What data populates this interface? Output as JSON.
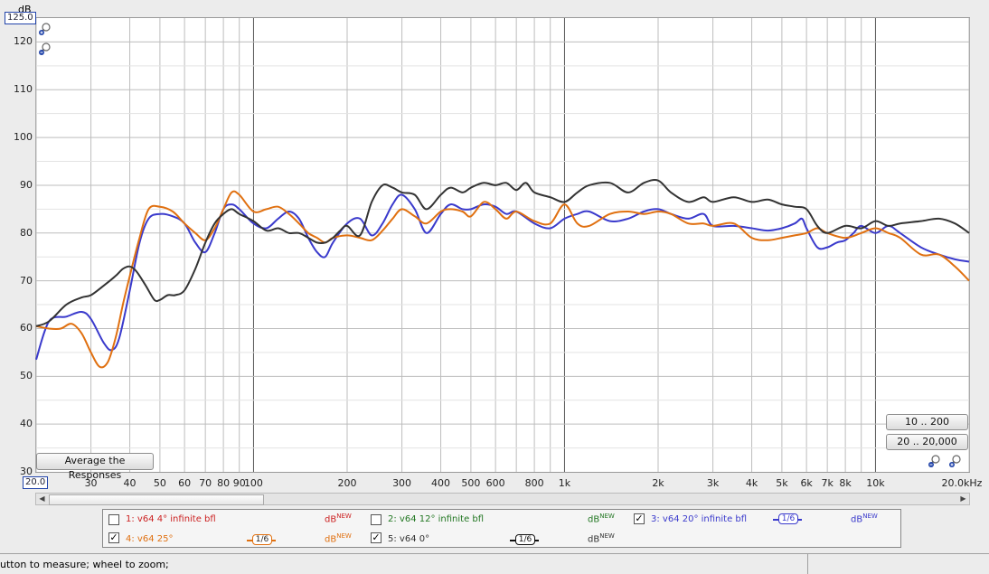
{
  "chart_data": {
    "type": "line",
    "x_scale": "log",
    "xlim": [
      20,
      20000
    ],
    "ylim": [
      30,
      125
    ],
    "y_unit": "dB",
    "x_unit": "kHz",
    "y_ticks": [
      "125.0",
      "120",
      "110",
      "100",
      "90",
      "80",
      "70",
      "60",
      "50",
      "40",
      "30"
    ],
    "y_tick_values": [
      125,
      120,
      110,
      100,
      90,
      80,
      70,
      60,
      50,
      40,
      30
    ],
    "x_tick_labels": [
      {
        "label": "20.0",
        "value": 20
      },
      {
        "label": "30",
        "value": 30
      },
      {
        "label": "40",
        "value": 40
      },
      {
        "label": "50",
        "value": 50
      },
      {
        "label": "60",
        "value": 60
      },
      {
        "label": "70",
        "value": 70
      },
      {
        "label": "80",
        "value": 80
      },
      {
        "label": "90",
        "value": 90
      },
      {
        "label": "100",
        "value": 100
      },
      {
        "label": "200",
        "value": 200
      },
      {
        "label": "300",
        "value": 300
      },
      {
        "label": "400",
        "value": 400
      },
      {
        "label": "500",
        "value": 500
      },
      {
        "label": "600",
        "value": 600
      },
      {
        "label": "800",
        "value": 800
      },
      {
        "label": "1k",
        "value": 1000
      },
      {
        "label": "2k",
        "value": 2000
      },
      {
        "label": "3k",
        "value": 3000
      },
      {
        "label": "4k",
        "value": 4000
      },
      {
        "label": "5k",
        "value": 5000
      },
      {
        "label": "6k",
        "value": 6000
      },
      {
        "label": "7k",
        "value": 7000
      },
      {
        "label": "8k",
        "value": 8000
      },
      {
        "label": "10k",
        "value": 10000
      },
      {
        "label": "20.0kHz",
        "value": 20000
      }
    ],
    "series": [
      {
        "name": "3: v64 20° infinite bfl",
        "color": "#3a3acc",
        "x": [
          20,
          22,
          25,
          28,
          30,
          33,
          35,
          37,
          40,
          43,
          46,
          50,
          55,
          60,
          65,
          70,
          75,
          80,
          85,
          90,
          100,
          110,
          120,
          130,
          140,
          150,
          160,
          170,
          180,
          200,
          220,
          240,
          260,
          280,
          300,
          330,
          360,
          400,
          430,
          470,
          500,
          550,
          600,
          650,
          700,
          800,
          900,
          1000,
          1100,
          1200,
          1400,
          1600,
          1800,
          2000,
          2200,
          2500,
          2800,
          3000,
          3500,
          4000,
          4500,
          5000,
          5500,
          5800,
          6000,
          6500,
          7000,
          7500,
          8000,
          8500,
          9000,
          10000,
          11000,
          12000,
          14000,
          16000,
          18000,
          20000
        ],
        "y": [
          53.5,
          61.5,
          62.5,
          63.5,
          62,
          57,
          55.5,
          58,
          68,
          78,
          83,
          84,
          83.5,
          82,
          78,
          76,
          80,
          85,
          86,
          85,
          82,
          81,
          83,
          84.5,
          83,
          79,
          76,
          75,
          78,
          82,
          83,
          79.5,
          82,
          86,
          88,
          85,
          80,
          84,
          86,
          85,
          85,
          86,
          85.5,
          84,
          84.5,
          82,
          81,
          83,
          84,
          84.5,
          82.5,
          83,
          84.5,
          85,
          84,
          83,
          84,
          81.5,
          81.5,
          81,
          80.5,
          81,
          82,
          83,
          81,
          77,
          77,
          78,
          78.5,
          80,
          81.5,
          80,
          81.5,
          80,
          77,
          75.5,
          74.5,
          74
        ]
      },
      {
        "name": "4: v64 25°",
        "color": "#e07010",
        "x": [
          20,
          22,
          24,
          26,
          28,
          30,
          32,
          34,
          36,
          38,
          40,
          43,
          46,
          50,
          55,
          60,
          65,
          70,
          75,
          80,
          85,
          90,
          100,
          110,
          120,
          130,
          140,
          150,
          160,
          170,
          180,
          200,
          220,
          240,
          260,
          280,
          300,
          330,
          360,
          400,
          430,
          470,
          500,
          550,
          600,
          650,
          700,
          800,
          900,
          1000,
          1100,
          1200,
          1400,
          1600,
          1800,
          2000,
          2200,
          2500,
          2800,
          3000,
          3500,
          4000,
          4500,
          5000,
          5500,
          6000,
          6500,
          7000,
          8000,
          9000,
          10000,
          11000,
          12000,
          14000,
          16000,
          18000,
          20000
        ],
        "y": [
          60.5,
          60,
          60,
          61,
          59,
          55,
          52,
          53,
          58,
          65,
          71,
          79,
          85,
          85.5,
          84.5,
          82,
          80,
          78.5,
          81,
          85,
          88.5,
          88,
          84.5,
          85,
          85.5,
          84,
          82,
          80,
          79,
          78,
          79,
          79.5,
          79,
          78.5,
          80.5,
          83,
          85,
          83.5,
          82,
          84.5,
          85,
          84.5,
          83.5,
          86.5,
          85,
          83,
          84.5,
          82.5,
          82,
          86,
          82,
          81.5,
          84,
          84.5,
          84,
          84.5,
          84,
          82,
          82,
          81.5,
          82,
          79,
          78.5,
          79,
          79.5,
          80,
          81,
          80,
          79,
          80,
          81,
          80,
          79,
          75.5,
          75.5,
          73,
          70
        ]
      },
      {
        "name": "5: v64 0°",
        "color": "#333333",
        "x": [
          20,
          22,
          25,
          28,
          30,
          33,
          36,
          38,
          40,
          42,
          45,
          48,
          50,
          53,
          56,
          60,
          65,
          70,
          75,
          80,
          85,
          90,
          100,
          110,
          120,
          130,
          140,
          150,
          160,
          170,
          180,
          190,
          200,
          220,
          240,
          260,
          280,
          300,
          330,
          360,
          400,
          430,
          470,
          500,
          550,
          600,
          650,
          700,
          750,
          800,
          900,
          1000,
          1100,
          1200,
          1400,
          1600,
          1800,
          2000,
          2200,
          2500,
          2800,
          3000,
          3500,
          4000,
          4500,
          5000,
          5500,
          6000,
          6500,
          7000,
          8000,
          9000,
          10000,
          11000,
          12000,
          14000,
          16000,
          18000,
          20000
        ],
        "y": [
          60.5,
          61.5,
          65,
          66.5,
          67,
          69,
          71,
          72.5,
          73,
          72,
          69,
          66,
          66,
          67,
          67,
          68,
          72.5,
          78,
          82,
          84,
          85,
          84,
          82.5,
          80.5,
          81,
          80,
          80,
          79,
          78,
          78,
          79,
          80.5,
          81.5,
          79.5,
          86.5,
          90,
          89.5,
          88.5,
          88,
          85,
          88,
          89.5,
          88.5,
          89.5,
          90.5,
          90,
          90.5,
          89,
          90.5,
          88.5,
          87.5,
          86.5,
          88.5,
          90,
          90.5,
          88.5,
          90.5,
          91,
          88.5,
          86.5,
          87.5,
          86.5,
          87.5,
          86.5,
          87,
          86,
          85.5,
          85,
          81.5,
          80,
          81.5,
          81,
          82.5,
          81.5,
          82,
          82.5,
          83,
          82,
          80
        ]
      }
    ]
  },
  "ui": {
    "y_unit_label": "dB",
    "button_average": "Average the Responses",
    "button_range_1": "10 .. 200",
    "button_range_2": "20 .. 20,000",
    "status_text": "utton to measure; wheel to zoom;"
  },
  "legend": {
    "items": [
      {
        "label": "1: v64 4° infinite bfl",
        "color": "#cc2222",
        "checked": false,
        "db": "dB",
        "db_sup": "NEW",
        "db_color": "#cc2222",
        "smoothing": ""
      },
      {
        "label": "2: v64 12° infinite bfl",
        "color": "#227722",
        "checked": false,
        "db": "dB",
        "db_sup": "NEW",
        "db_color": "#227722",
        "smoothing": ""
      },
      {
        "label": "3: v64 20° infinite bfl",
        "color": "#3a3acc",
        "checked": true,
        "db": "dB",
        "db_sup": "NEW",
        "db_color": "#3a3acc",
        "smoothing": "1/6"
      },
      {
        "label": "4: v64 25°",
        "color": "#e07010",
        "checked": true,
        "db": "dB",
        "db_sup": "NEW",
        "db_color": "#e07010",
        "smoothing": "1/6"
      },
      {
        "label": "5: v64 0°",
        "color": "#333333",
        "checked": true,
        "db": "dB",
        "db_sup": "NEW",
        "db_color": "#333333",
        "smoothing": "1/6"
      }
    ],
    "check_mark": "✓"
  }
}
